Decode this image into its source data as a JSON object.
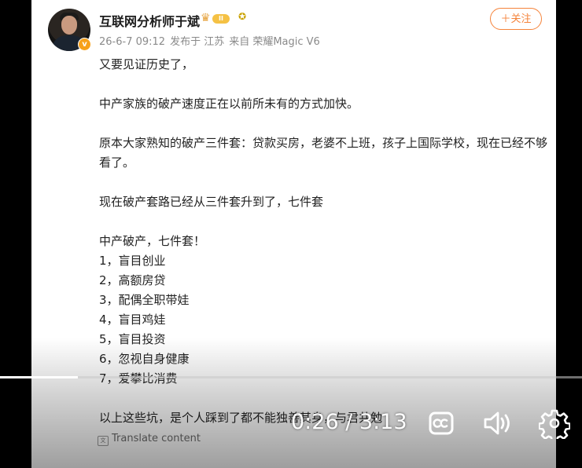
{
  "post": {
    "username": "互联网分析师于斌",
    "level_badge": "II",
    "verified_mark": "v",
    "meta": {
      "date": "26-6-7 09:12",
      "location": "发布于 江苏",
      "source": "来自 荣耀Magic V6"
    },
    "follow_label": "＋关注",
    "paragraphs": [
      "又要见证历史了，",
      "中产家族的破产速度正在以前所未有的方式加快。",
      "原本大家熟知的破产三件套：贷款买房，老婆不上班，孩子上国际学校，现在已经不够看了。",
      "现在破产套路已经从三件套升到了，七件套"
    ],
    "list_title": "中产破产，七件套！",
    "list_items": [
      "1，盲目创业",
      "2，高额房贷",
      "3，配偶全职带娃",
      "4，盲目鸡娃",
      "5，盲目投资",
      "6，忽视自身健康",
      "7，爱攀比消费"
    ],
    "closing_line": "以上这些坑，是个人踩到了都不能独善其身，与君共勉",
    "translate_label": "Translate content",
    "translate_icon_text": "文"
  },
  "video_player": {
    "time_display": "0:26 / 3:13",
    "progress_fraction": 0.134,
    "icons": [
      "closed-captions-icon",
      "volume-icon",
      "settings-gear-icon"
    ]
  },
  "colors": {
    "accent": "#f5833a",
    "badge_gold": "#f5c144",
    "verified": "#f7a11b"
  }
}
